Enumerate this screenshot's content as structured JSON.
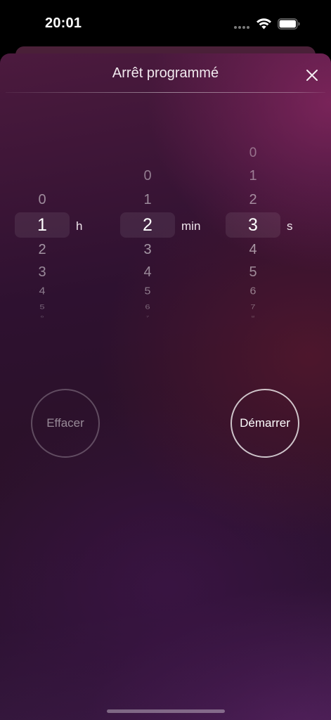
{
  "status_bar": {
    "time": "20:01"
  },
  "sheet": {
    "title": "Arrêt programmé"
  },
  "pickers": {
    "hours": {
      "unit": "h",
      "selected": "1",
      "above": [
        "0"
      ],
      "below": [
        "2",
        "3",
        "4",
        "5",
        "6"
      ]
    },
    "minutes": {
      "unit": "min",
      "selected": "2",
      "above": [
        "0",
        "1"
      ],
      "below": [
        "3",
        "4",
        "5",
        "6",
        "7"
      ]
    },
    "seconds": {
      "unit": "s",
      "selected": "3",
      "above": [
        "0",
        "1",
        "2"
      ],
      "below": [
        "4",
        "5",
        "6",
        "7",
        "8"
      ]
    }
  },
  "buttons": {
    "clear_label": "Effacer",
    "start_label": "Démarrer"
  },
  "icons": {
    "close": "close-icon",
    "wifi": "wifi-icon",
    "battery": "battery-icon"
  }
}
